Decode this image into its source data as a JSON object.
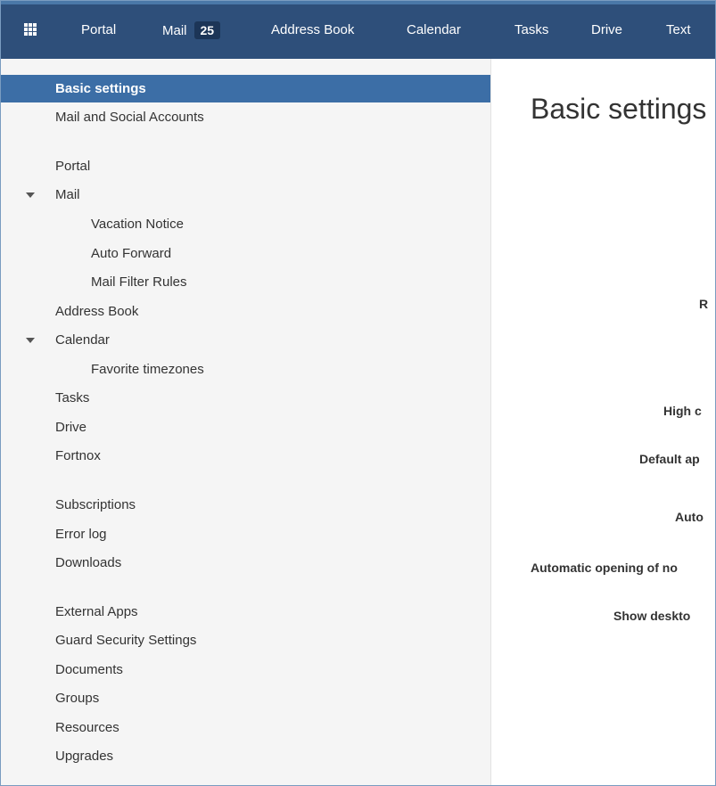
{
  "topbar": {
    "launcher_icon": "grid-icon",
    "items": [
      {
        "label": "Portal"
      },
      {
        "label": "Mail",
        "badge": "25"
      },
      {
        "label": "Address Book"
      },
      {
        "label": "Calendar"
      },
      {
        "label": "Tasks"
      },
      {
        "label": "Drive"
      },
      {
        "label": "Text"
      }
    ]
  },
  "sidebar": {
    "items": [
      {
        "label": "Basic settings",
        "active": true
      },
      {
        "label": "Mail and Social Accounts"
      },
      {
        "label": "Portal"
      },
      {
        "label": "Mail",
        "expanded": true
      },
      {
        "label": "Vacation Notice",
        "sub": true
      },
      {
        "label": "Auto Forward",
        "sub": true
      },
      {
        "label": "Mail Filter Rules",
        "sub": true
      },
      {
        "label": "Address Book"
      },
      {
        "label": "Calendar",
        "expanded": true
      },
      {
        "label": "Favorite timezones",
        "sub": true
      },
      {
        "label": "Tasks"
      },
      {
        "label": "Drive"
      },
      {
        "label": "Fortnox"
      },
      {
        "label": "Subscriptions"
      },
      {
        "label": "Error log"
      },
      {
        "label": "Downloads"
      },
      {
        "label": "External Apps"
      },
      {
        "label": "Guard Security Settings"
      },
      {
        "label": "Documents"
      },
      {
        "label": "Groups"
      },
      {
        "label": "Resources"
      },
      {
        "label": "Upgrades"
      }
    ]
  },
  "main": {
    "title": "Basic settings",
    "row_labels": [
      "R",
      "High c",
      "Default ap",
      "Auto",
      "Automatic opening of no",
      "Show deskto"
    ]
  },
  "colors": {
    "topbar_bg": "#2e4f7a",
    "active_bg": "#3c6ea6",
    "sidebar_bg": "#f5f5f5"
  }
}
